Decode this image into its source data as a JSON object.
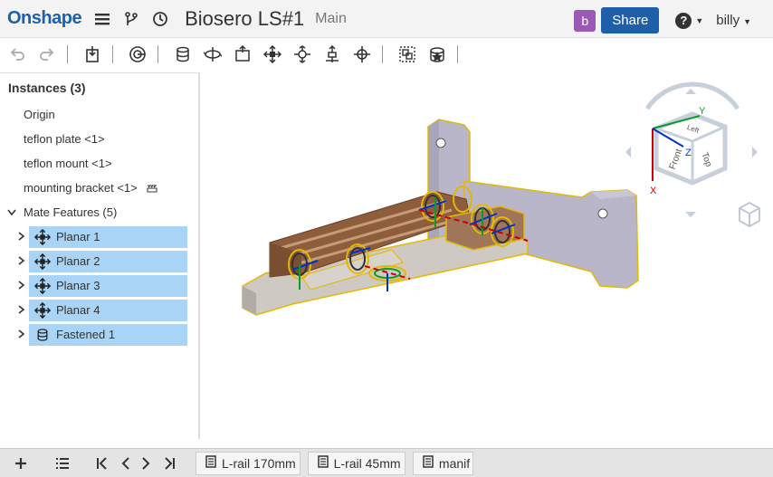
{
  "header": {
    "logo": "Onshape",
    "doc_title": "Biosero LS#1",
    "workspace": "Main",
    "avatar_letter": "b",
    "share_label": "Share",
    "user": "billy"
  },
  "panel": {
    "title": "Instances (3)",
    "instances": [
      {
        "label": "Origin"
      },
      {
        "label": "teflon plate <1>"
      },
      {
        "label": "teflon mount <1>"
      },
      {
        "label": "mounting bracket <1>"
      }
    ],
    "mates_header": "Mate Features (5)",
    "mates": [
      {
        "label": "Planar 1",
        "icon": "planar-mate-icon"
      },
      {
        "label": "Planar 2",
        "icon": "planar-mate-icon"
      },
      {
        "label": "Planar 3",
        "icon": "planar-mate-icon"
      },
      {
        "label": "Planar 4",
        "icon": "planar-mate-icon"
      },
      {
        "label": "Fastened 1",
        "icon": "fastened-mate-icon"
      }
    ]
  },
  "viewcube": {
    "faces": [
      "Front",
      "Top",
      "Left"
    ],
    "axes": [
      "X",
      "Y",
      "Z"
    ]
  },
  "tabs": [
    {
      "label": "L-rail 170mm"
    },
    {
      "label": "L-rail 45mm"
    },
    {
      "label": "manif"
    }
  ],
  "colors": {
    "brand": "#1f5faa",
    "selection": "#a9d4f5",
    "avatar": "#9b59b6",
    "part_brown": "#a0765a",
    "part_gray": "#b8b6c8",
    "highlight": "#e5b800"
  }
}
